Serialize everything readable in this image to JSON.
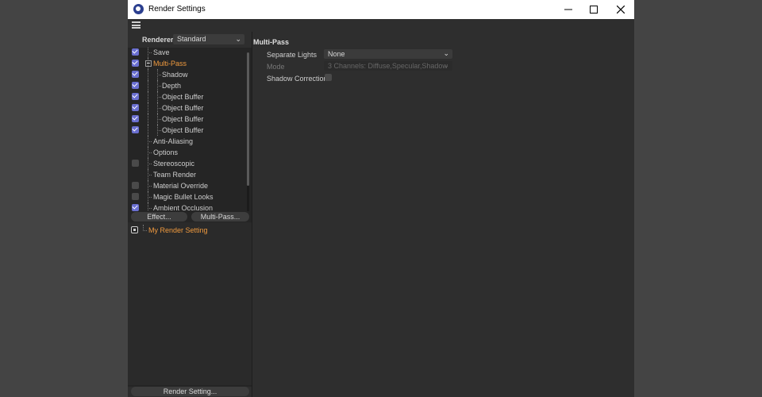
{
  "window": {
    "title": "Render Settings",
    "minimize": "—",
    "maximize": "☐",
    "close": "✕"
  },
  "renderer": {
    "label": "Renderer",
    "value": "Standard"
  },
  "tree": [
    {
      "label": "Save",
      "check": "on",
      "level": 0
    },
    {
      "label": "Multi-Pass",
      "check": "on",
      "level": 0,
      "selected": true,
      "expanded": true
    },
    {
      "label": "Shadow",
      "check": "on",
      "level": 1
    },
    {
      "label": "Depth",
      "check": "on",
      "level": 1
    },
    {
      "label": "Object Buffer",
      "check": "on",
      "level": 1
    },
    {
      "label": "Object Buffer",
      "check": "on",
      "level": 1
    },
    {
      "label": "Object Buffer",
      "check": "on",
      "level": 1
    },
    {
      "label": "Object Buffer",
      "check": "on",
      "level": 1
    },
    {
      "label": "Anti-Aliasing",
      "check": "none",
      "level": 0
    },
    {
      "label": "Options",
      "check": "none",
      "level": 0
    },
    {
      "label": "Stereoscopic",
      "check": "off",
      "level": 0
    },
    {
      "label": "Team Render",
      "check": "none",
      "level": 0
    },
    {
      "label": "Material Override",
      "check": "off",
      "level": 0
    },
    {
      "label": "Magic Bullet Looks",
      "check": "off",
      "level": 0
    },
    {
      "label": "Ambient Occlusion",
      "check": "on",
      "level": 0
    }
  ],
  "buttons": {
    "effect": "Effect...",
    "multipass": "Multi-Pass...",
    "render_setting": "Render Setting..."
  },
  "settings_list": [
    {
      "label": "My Render Setting",
      "active": true
    }
  ],
  "panel": {
    "title": "Multi-Pass",
    "separate_lights": {
      "label": "Separate Lights",
      "value": "None"
    },
    "mode": {
      "label": "Mode",
      "value": "3 Channels: Diffuse,Specular,Shadow"
    },
    "shadow_correction": {
      "label": "Shadow Correction",
      "checked": false
    }
  }
}
